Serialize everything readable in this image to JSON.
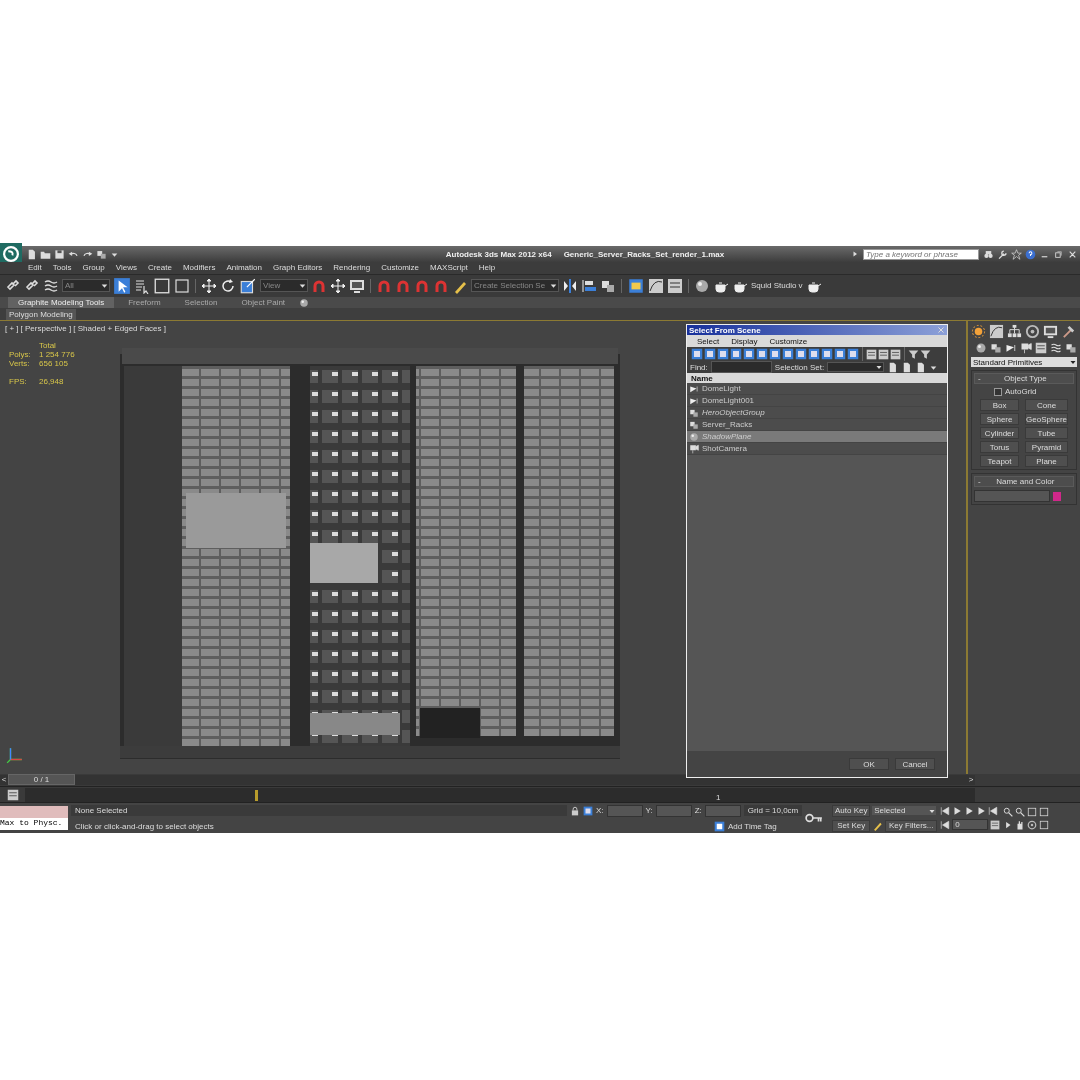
{
  "title_bar": {
    "app": "Autodesk 3ds Max  2012 x64",
    "file": "Generic_Server_Racks_Set_render_1.max",
    "search": {
      "placeholder": "Type a keyword or phrase"
    }
  },
  "menu": [
    "Edit",
    "Tools",
    "Group",
    "Views",
    "Create",
    "Modifiers",
    "Animation",
    "Graph Editors",
    "Rendering",
    "Customize",
    "MAXScript",
    "Help"
  ],
  "toolbar": {
    "selection_filter": "All",
    "coordinate_system": "View",
    "named_selection": "Create Selection Se",
    "workspace": "Squid Studio v"
  },
  "ribbon": {
    "tabs": [
      {
        "label": "Graphite Modeling Tools",
        "selected": true
      },
      {
        "label": "Freeform",
        "selected": false
      },
      {
        "label": "Selection",
        "selected": false
      },
      {
        "label": "Object Paint",
        "selected": false
      }
    ],
    "panel": "Polygon Modeling"
  },
  "viewport": {
    "labels": [
      "[ + ]",
      "[ Perspective ]",
      "[ Shaded + Edged Faces ]"
    ],
    "stats": {
      "header": "Total",
      "rows": [
        {
          "label": "Polys:",
          "value": "1 254 776"
        },
        {
          "label": "Verts:",
          "value": "656 105"
        }
      ],
      "fps_label": "FPS:",
      "fps": "26,948"
    }
  },
  "dialog": {
    "title": "Select From Scene",
    "menu": [
      "Select",
      "Display",
      "Customize"
    ],
    "find_label": "Find:",
    "selection_set_label": "Selection Set:",
    "column": "Name",
    "objects": [
      {
        "name": "DomeLight",
        "kind": "light",
        "hidden": false,
        "selected": false
      },
      {
        "name": "DomeLight001",
        "kind": "light",
        "hidden": false,
        "selected": false
      },
      {
        "name": "HeroObjectGroup",
        "kind": "group",
        "hidden": true,
        "selected": false
      },
      {
        "name": "Server_Racks",
        "kind": "group",
        "hidden": false,
        "selected": false
      },
      {
        "name": "ShadowPlane",
        "kind": "geometry",
        "hidden": true,
        "selected": true
      },
      {
        "name": "ShotCamera",
        "kind": "camera",
        "hidden": false,
        "selected": false
      }
    ],
    "buttons": [
      "OK",
      "Cancel"
    ]
  },
  "command_panel": {
    "category": "Standard Primitives",
    "object_type": {
      "toggle": "-",
      "title": "Object Type",
      "autogrid": {
        "label": "AutoGrid",
        "checked": false
      },
      "buttons": [
        "Box",
        "Cone",
        "Sphere",
        "GeoSphere",
        "Cylinder",
        "Tube",
        "Torus",
        "Pyramid",
        "Teapot",
        "Plane"
      ]
    },
    "name_and_color": {
      "toggle": "-",
      "title": "Name and Color",
      "color": "#d0288a"
    }
  },
  "time_slider": {
    "prev": "<",
    "frame": "0 / 1",
    "level": 0,
    "next": ">",
    "track_label": "1"
  },
  "status": {
    "listener": "Max to Physc.",
    "selection": "None Selected",
    "prompt": "Click or click-and-drag to select objects",
    "x_label": "X:",
    "y_label": "Y:",
    "z_label": "Z:",
    "grid": "Grid = 10,0cm",
    "add_time_tag": "Add Time Tag",
    "auto_key": "Auto Key",
    "key_mode": "Selected",
    "set_key": "Set Key",
    "key_filters": "Key Filters...",
    "frame": "0"
  }
}
